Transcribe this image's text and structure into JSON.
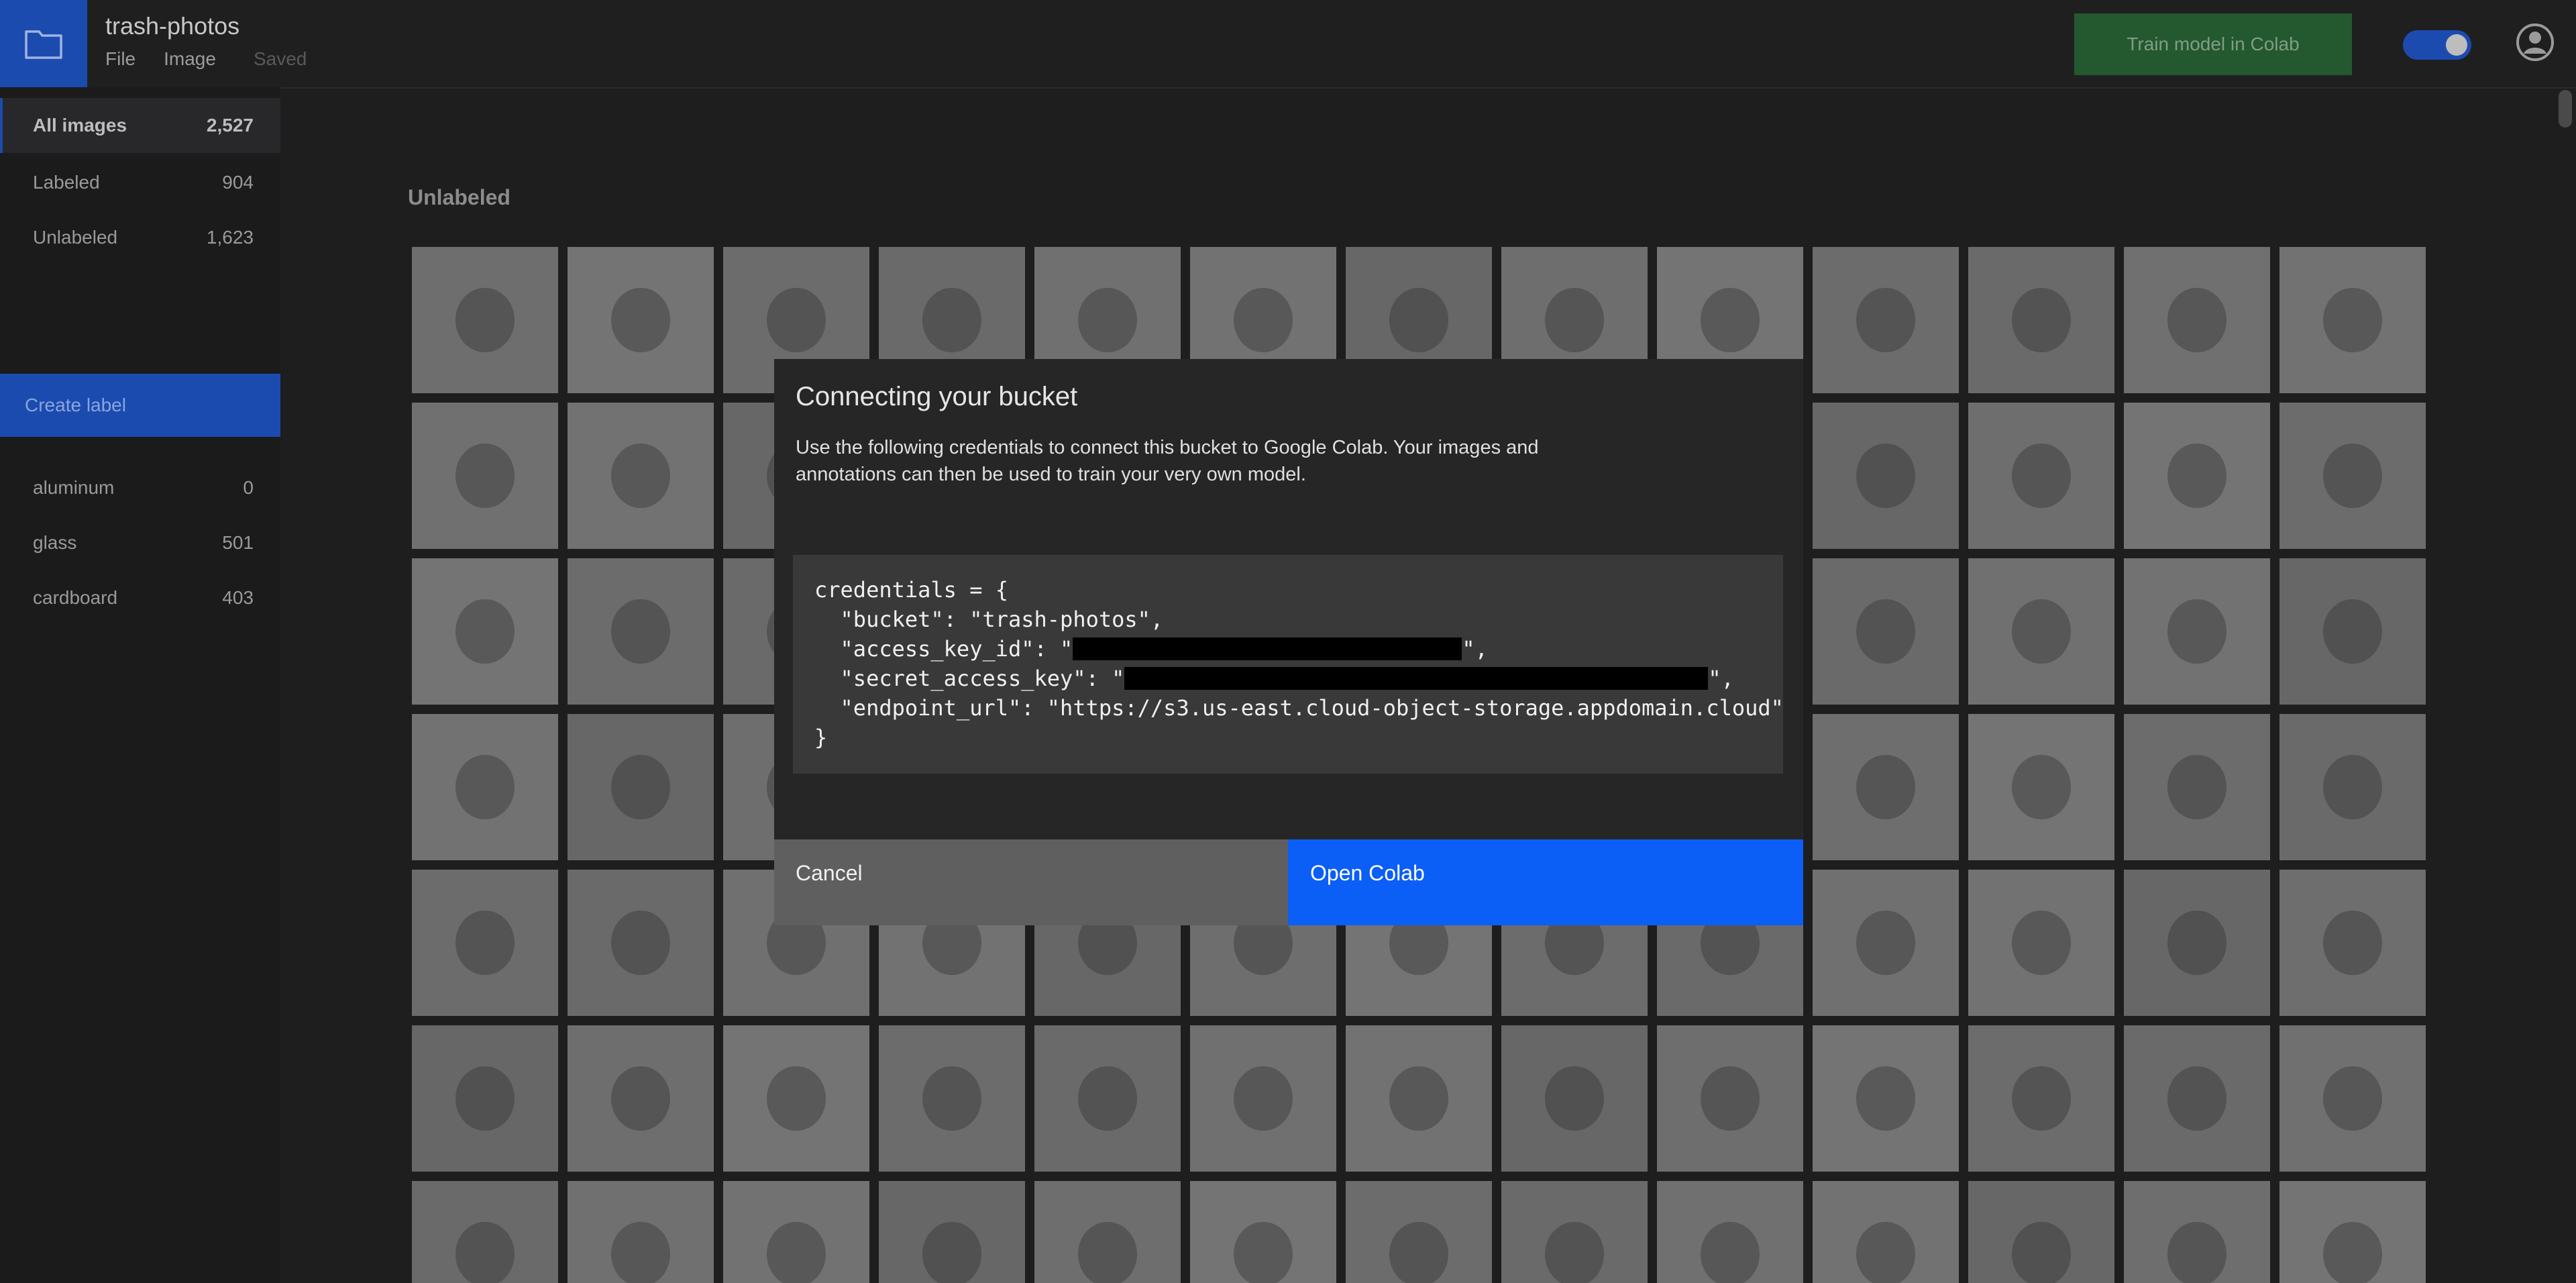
{
  "app": {
    "title": "trash-photos",
    "menu": [
      "File",
      "Image"
    ],
    "status": "Saved",
    "train_button": "Train model in Colab",
    "accent": "#0b5ff6",
    "icons": [
      "folder-icon",
      "toggle-switch",
      "user-avatar-icon"
    ]
  },
  "sidebar": {
    "filters": [
      {
        "label": "All images",
        "count": "2,527"
      },
      {
        "label": "Labeled",
        "count": "904"
      },
      {
        "label": "Unlabeled",
        "count": "1,623"
      }
    ],
    "create_label": "Create label",
    "labels": [
      {
        "label": "aluminum",
        "count": "0"
      },
      {
        "label": "glass",
        "count": "501"
      },
      {
        "label": "cardboard",
        "count": "403"
      }
    ]
  },
  "main": {
    "section_title": "Unlabeled"
  },
  "modal": {
    "title": "Connecting your bucket",
    "description": "Use the following credentials to connect this bucket to Google Colab. Your images and annotations can then be used to train your very own model.",
    "code": {
      "open": "credentials = {",
      "bucket_line": "  \"bucket\": \"trash-photos\",",
      "access_key_prefix": "  \"access_key_id\": \"",
      "access_key_suffix": "\",",
      "secret_key_prefix": "  \"secret_access_key\": \"",
      "secret_key_suffix": "\",",
      "endpoint_line": "  \"endpoint_url\": \"https://s3.us-east.cloud-object-storage.appdomain.cloud\"",
      "close": "}"
    },
    "cancel": "Cancel",
    "open_colab": "Open Colab"
  }
}
